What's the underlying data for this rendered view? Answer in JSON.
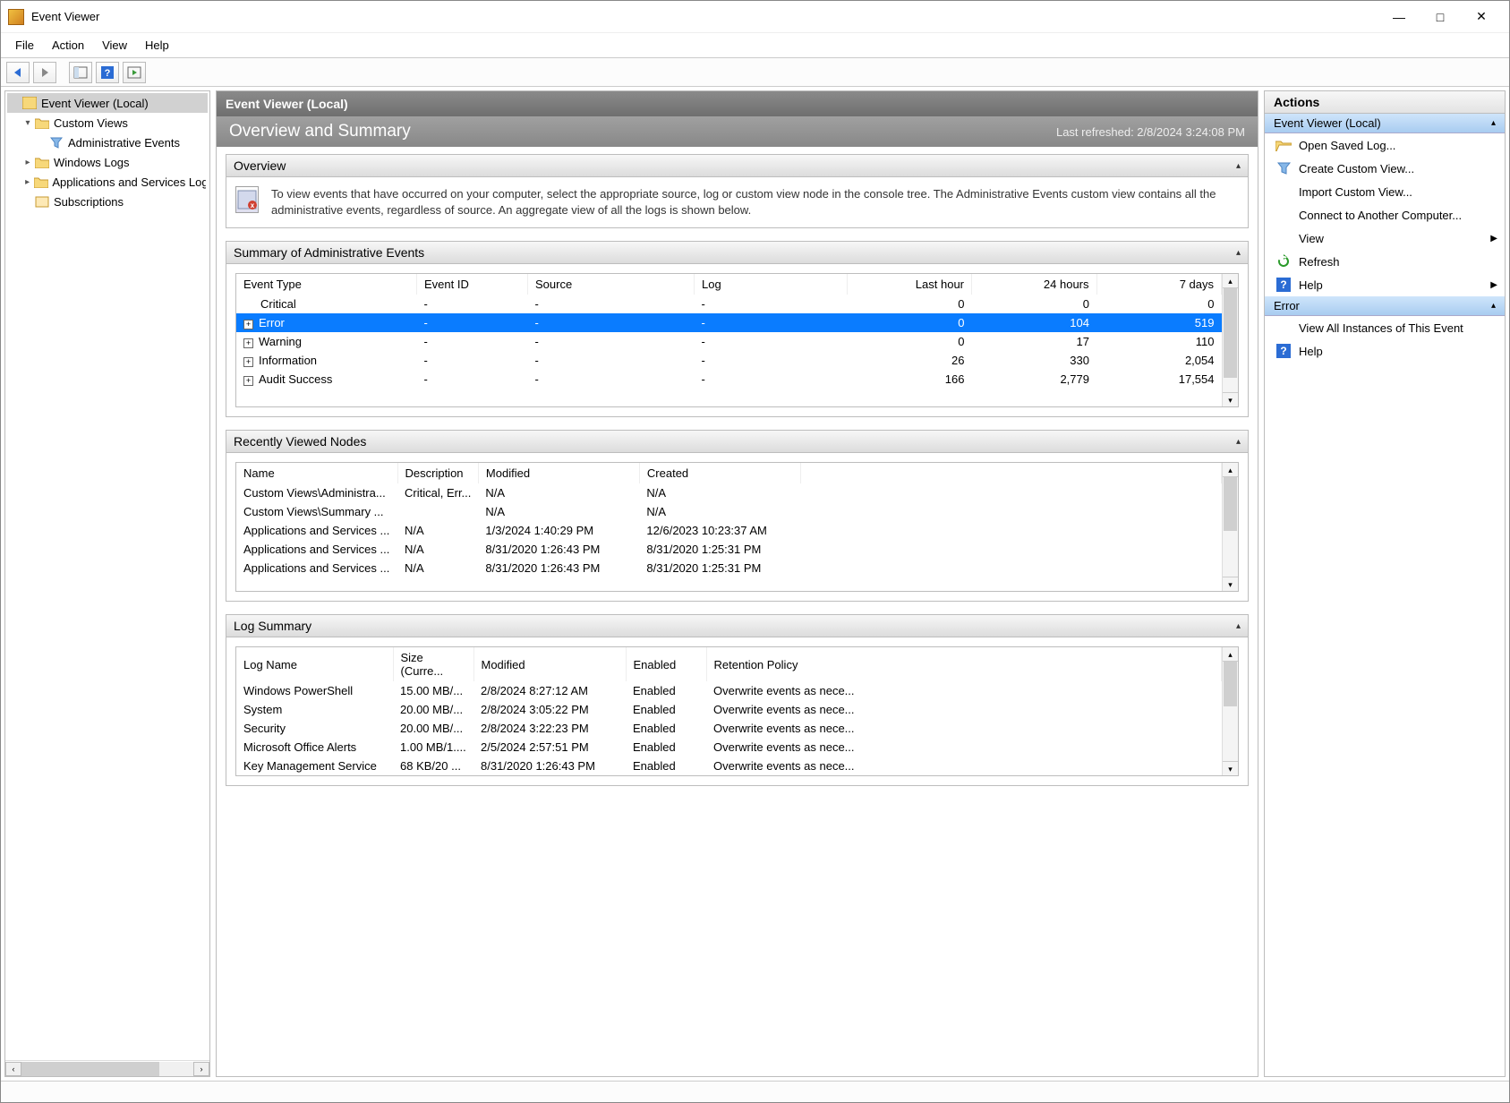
{
  "window": {
    "title": "Event Viewer"
  },
  "menu": {
    "file": "File",
    "action": "Action",
    "view": "View",
    "help": "Help"
  },
  "tree": {
    "root": "Event Viewer (Local)",
    "nodes": [
      {
        "label": "Custom Views",
        "expanded": true,
        "children": [
          {
            "label": "Administrative Events"
          }
        ]
      },
      {
        "label": "Windows Logs",
        "expanded": false
      },
      {
        "label": "Applications and Services Logs",
        "expanded": false
      },
      {
        "label": "Subscriptions",
        "expanded": null
      }
    ]
  },
  "center": {
    "header": "Event Viewer (Local)",
    "overview_title": "Overview and Summary",
    "last_refreshed": "Last refreshed: 2/8/2024 3:24:08 PM",
    "overview_section": "Overview",
    "overview_text": "To view events that have occurred on your computer, select the appropriate source, log or custom view node in the console tree. The Administrative Events custom view contains all the administrative events, regardless of source. An aggregate view of all the logs is shown below.",
    "summary_section": "Summary of Administrative Events",
    "summary_headers": {
      "type": "Event Type",
      "id": "Event ID",
      "source": "Source",
      "log": "Log",
      "last_hour": "Last hour",
      "h24": "24 hours",
      "d7": "7 days"
    },
    "summary_rows": [
      {
        "exp": "",
        "type": "Critical",
        "id": "-",
        "source": "-",
        "log": "-",
        "lh": "0",
        "h24": "0",
        "d7": "0"
      },
      {
        "exp": "+",
        "type": "Error",
        "id": "-",
        "source": "-",
        "log": "-",
        "lh": "0",
        "h24": "104",
        "d7": "519",
        "selected": true
      },
      {
        "exp": "+",
        "type": "Warning",
        "id": "-",
        "source": "-",
        "log": "-",
        "lh": "0",
        "h24": "17",
        "d7": "110"
      },
      {
        "exp": "+",
        "type": "Information",
        "id": "-",
        "source": "-",
        "log": "-",
        "lh": "26",
        "h24": "330",
        "d7": "2,054"
      },
      {
        "exp": "+",
        "type": "Audit Success",
        "id": "-",
        "source": "-",
        "log": "-",
        "lh": "166",
        "h24": "2,779",
        "d7": "17,554"
      }
    ],
    "recent_section": "Recently Viewed Nodes",
    "recent_headers": {
      "name": "Name",
      "desc": "Description",
      "mod": "Modified",
      "created": "Created"
    },
    "recent_rows": [
      {
        "name": "Custom Views\\Administra...",
        "desc": "Critical, Err...",
        "mod": "N/A",
        "created": "N/A"
      },
      {
        "name": "Custom Views\\Summary ...",
        "desc": "",
        "mod": "N/A",
        "created": "N/A"
      },
      {
        "name": "Applications and Services ...",
        "desc": "N/A",
        "mod": "1/3/2024 1:40:29 PM",
        "created": "12/6/2023 10:23:37 AM"
      },
      {
        "name": "Applications and Services ...",
        "desc": "N/A",
        "mod": "8/31/2020 1:26:43 PM",
        "created": "8/31/2020 1:25:31 PM"
      },
      {
        "name": "Applications and Services ...",
        "desc": "N/A",
        "mod": "8/31/2020 1:26:43 PM",
        "created": "8/31/2020 1:25:31 PM"
      }
    ],
    "logsum_section": "Log Summary",
    "logsum_headers": {
      "name": "Log Name",
      "size": "Size (Curre...",
      "mod": "Modified",
      "enabled": "Enabled",
      "retention": "Retention Policy"
    },
    "logsum_rows": [
      {
        "name": "Windows PowerShell",
        "size": "15.00 MB/...",
        "mod": "2/8/2024 8:27:12 AM",
        "enabled": "Enabled",
        "ret": "Overwrite events as nece..."
      },
      {
        "name": "System",
        "size": "20.00 MB/...",
        "mod": "2/8/2024 3:05:22 PM",
        "enabled": "Enabled",
        "ret": "Overwrite events as nece..."
      },
      {
        "name": "Security",
        "size": "20.00 MB/...",
        "mod": "2/8/2024 3:22:23 PM",
        "enabled": "Enabled",
        "ret": "Overwrite events as nece..."
      },
      {
        "name": "Microsoft Office Alerts",
        "size": "1.00 MB/1....",
        "mod": "2/5/2024 2:57:51 PM",
        "enabled": "Enabled",
        "ret": "Overwrite events as nece..."
      },
      {
        "name": "Key Management Service",
        "size": "68 KB/20 ...",
        "mod": "8/31/2020 1:26:43 PM",
        "enabled": "Enabled",
        "ret": "Overwrite events as nece..."
      }
    ]
  },
  "actions": {
    "header": "Actions",
    "group1": "Event Viewer (Local)",
    "items1": [
      {
        "icon": "folder-open",
        "label": "Open Saved Log..."
      },
      {
        "icon": "filter",
        "label": "Create Custom View..."
      },
      {
        "icon": "",
        "label": "Import Custom View..."
      },
      {
        "icon": "",
        "label": "Connect to Another Computer..."
      },
      {
        "icon": "",
        "label": "View",
        "arrow": true
      },
      {
        "icon": "refresh",
        "label": "Refresh"
      },
      {
        "icon": "help",
        "label": "Help",
        "arrow": true
      }
    ],
    "group2": "Error",
    "items2": [
      {
        "icon": "",
        "label": "View All Instances of This Event"
      },
      {
        "icon": "help",
        "label": "Help"
      }
    ]
  }
}
